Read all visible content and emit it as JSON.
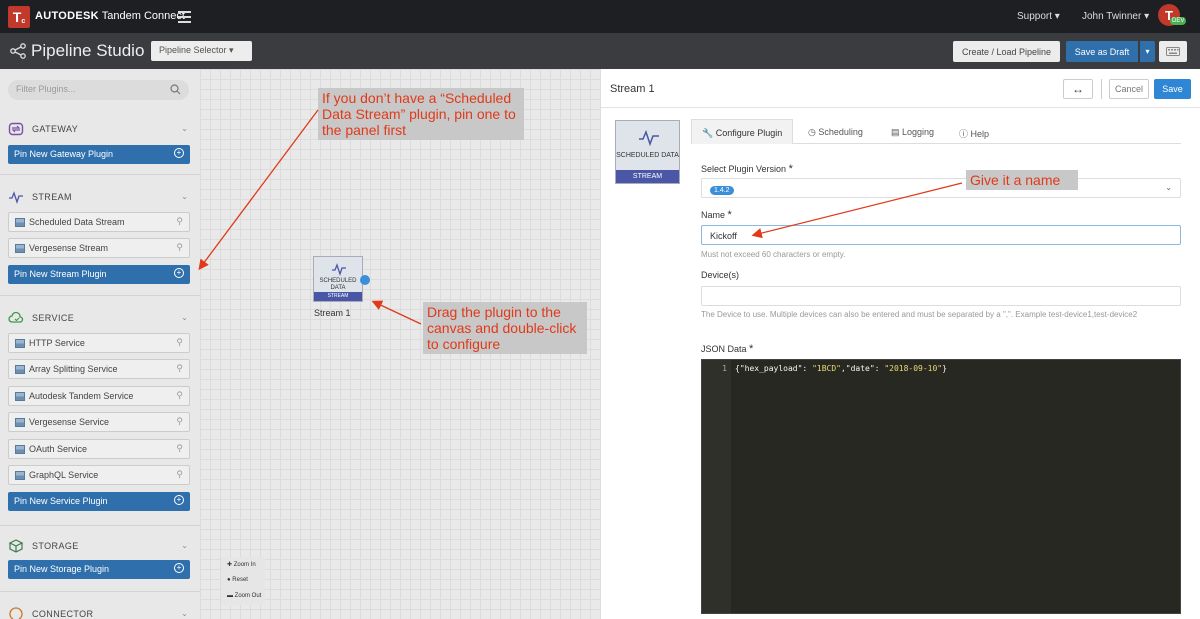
{
  "topbar": {
    "logo_letter": "T",
    "logo_sub": "c",
    "brand_bold": "AUTODESK",
    "brand_rest": "Tandem Connect",
    "support": "Support ▾",
    "user": "John Twinner ▾",
    "avatar_letter": "T",
    "avatar_badge": "DEV"
  },
  "studio": {
    "title": "Pipeline Studio",
    "selector": "Pipeline Selector  ▾",
    "create_load": "Create / Load Pipeline",
    "save_draft": "Save as Draft",
    "caret": "▾"
  },
  "sidebar": {
    "filter_placeholder": "Filter Plugins...",
    "sections": {
      "gateway": {
        "title": "GATEWAY",
        "pin": "Pin New Gateway Plugin"
      },
      "stream": {
        "title": "STREAM",
        "items": [
          "Scheduled Data Stream",
          "Vergesense Stream"
        ],
        "pin": "Pin New Stream Plugin"
      },
      "service": {
        "title": "SERVICE",
        "items": [
          "HTTP Service",
          "Array Splitting Service",
          "Autodesk Tandem Service",
          "Vergesense Service",
          "OAuth Service",
          "GraphQL Service"
        ],
        "pin": "Pin New Service Plugin"
      },
      "storage": {
        "title": "STORAGE",
        "pin": "Pin New Storage Plugin"
      },
      "connector": {
        "title": "CONNECTOR"
      }
    }
  },
  "canvas": {
    "node_label": "SCHEDULED DATA",
    "node_type": "STREAM",
    "node_caption": "Stream 1",
    "zoom_in": "Zoom In",
    "reset": "Reset",
    "zoom_out": "Zoom Out"
  },
  "annotations": {
    "pin_hint": "If you don’t have a “Scheduled Data Stream” plugin, pin one to the panel first",
    "drag_hint": "Drag the plugin to the canvas and double-click to configure",
    "name_hint": "Give it a name",
    "color": "#e03a1a"
  },
  "panel": {
    "title": "Stream 1",
    "expand": "↔",
    "cancel": "Cancel",
    "save": "Save",
    "thumb_label": "SCHEDULED DATA",
    "thumb_type": "STREAM",
    "tabs": [
      "Configure Plugin",
      "Scheduling",
      "Logging",
      "Help"
    ],
    "version_label": "Select Plugin Version",
    "version_value": "1.4.2",
    "name_label": "Name",
    "name_value": "Kickoff",
    "name_hint": "Must not exceed 60 characters or empty.",
    "devices_label": "Device(s)",
    "devices_hint": "The Device to use. Multiple devices can also be entered and must be separated by a \",\". Example test-device1,test-device2",
    "json_label": "JSON Data",
    "json_line_no": "1",
    "json_open": "{\"hex_payload\": ",
    "json_hex": "\"1BCD\"",
    "json_mid": ",\"date\": ",
    "json_date": "\"2018-09-10\"",
    "json_close": "}",
    "required_mark": "*"
  }
}
